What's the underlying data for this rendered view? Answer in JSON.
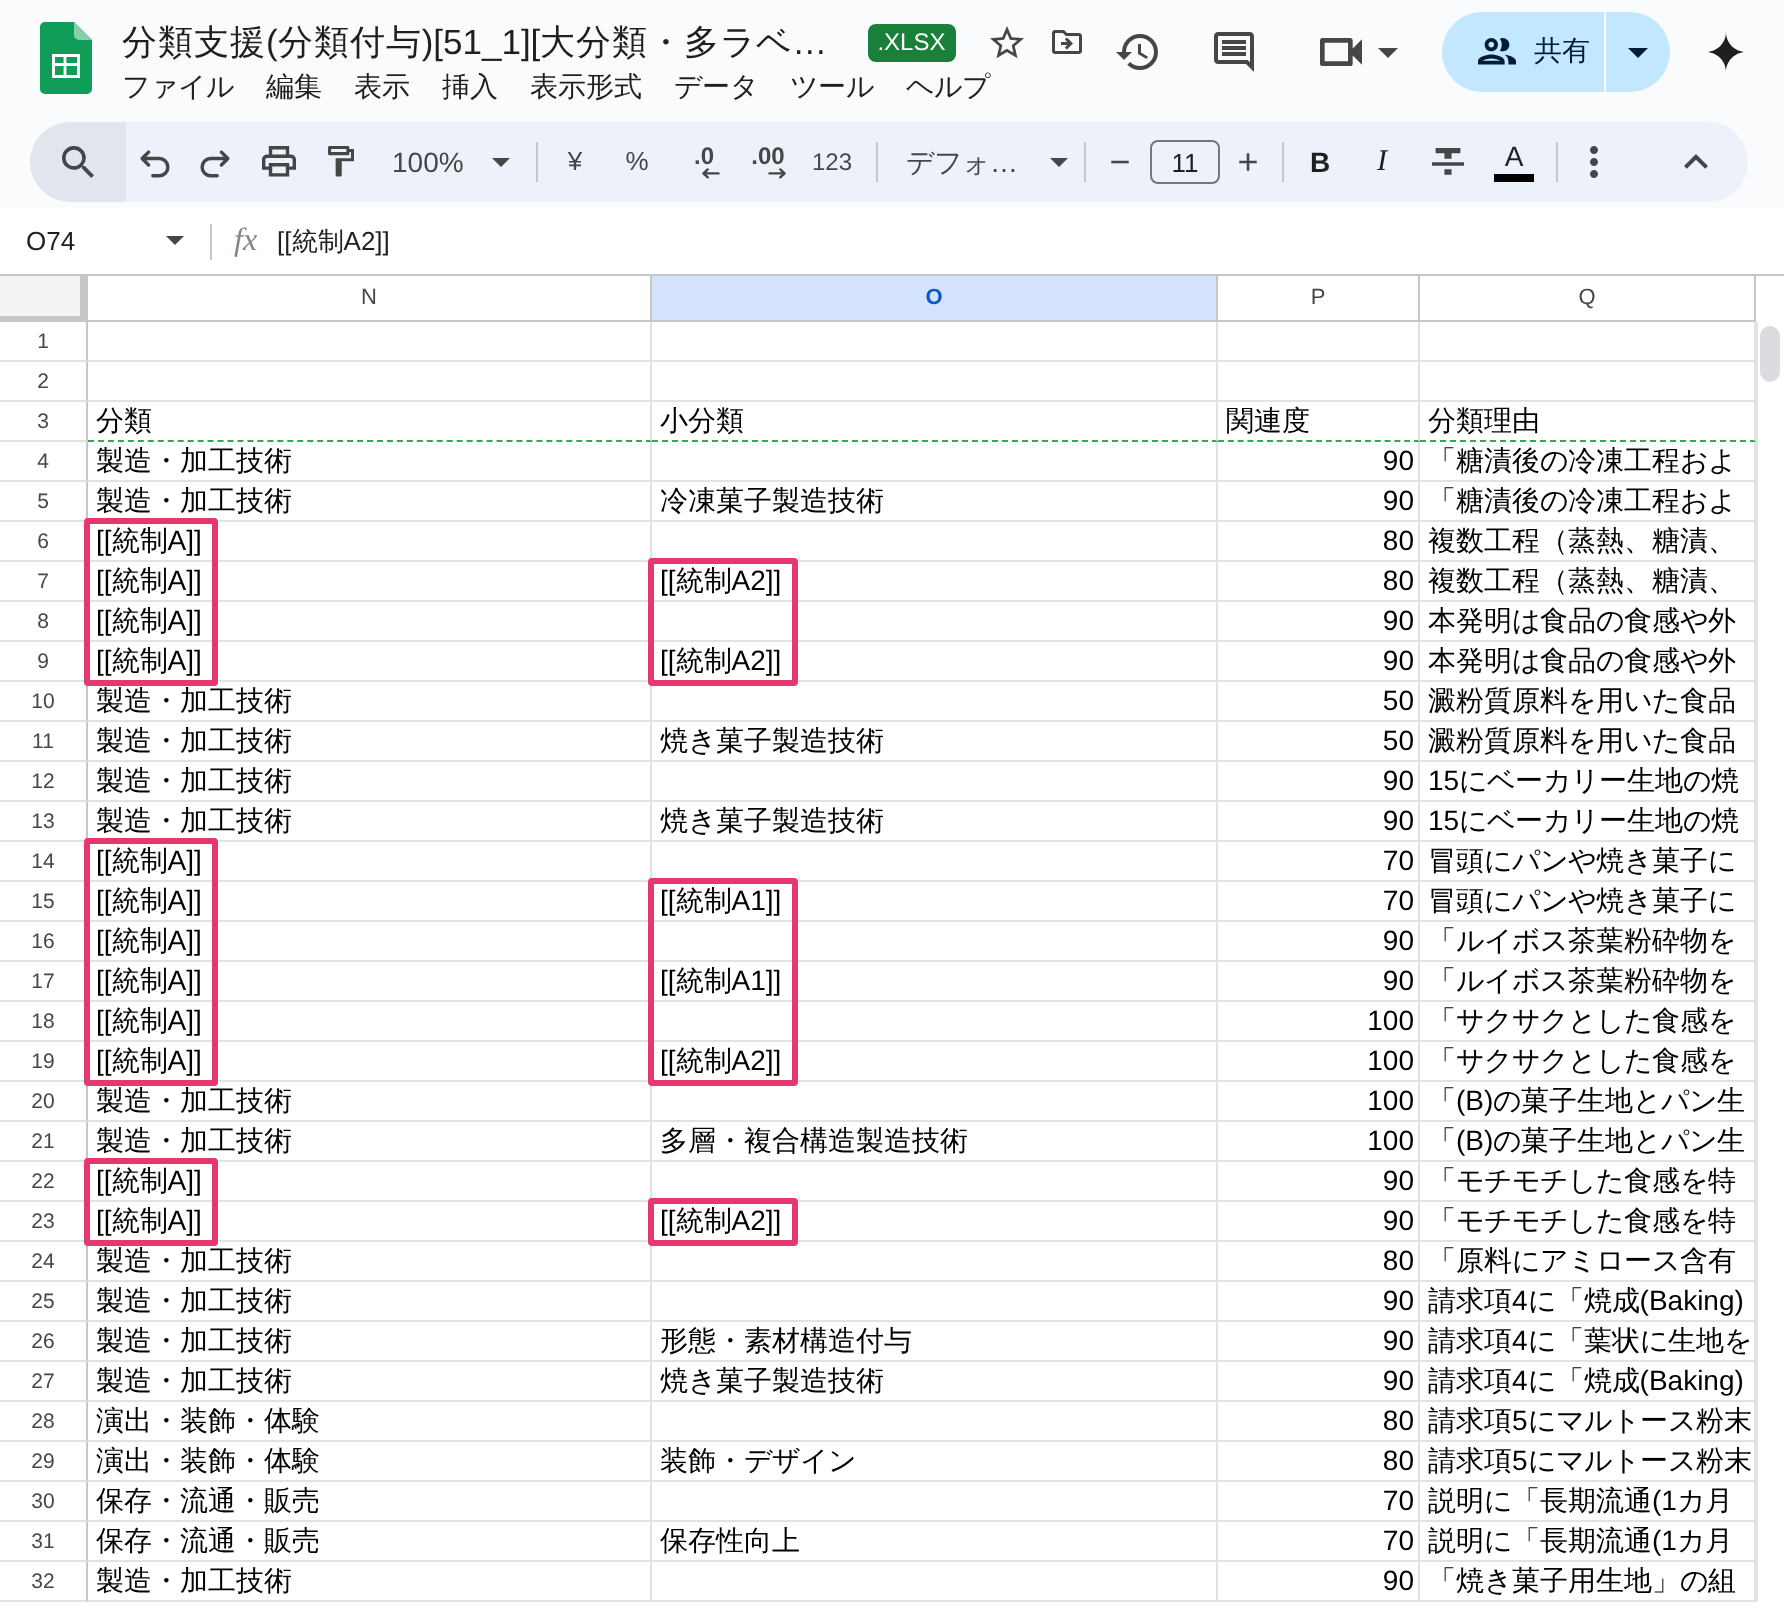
{
  "header": {
    "title": "分類支援(分類付与)[51_1][大分類・多ラベ…",
    "file_badge": ".XLSX",
    "menu": [
      "ファイル",
      "編集",
      "表示",
      "挿入",
      "表示形式",
      "データ",
      "ツール",
      "ヘルプ"
    ],
    "share_label": "共有"
  },
  "toolbar": {
    "zoom": "100%",
    "currency": "¥",
    "percent": "%",
    "decrease_decimal": ".0",
    "increase_decimal": ".00",
    "number_format": "123",
    "font": "デフォ…",
    "font_size_minus": "−",
    "font_size": "11",
    "font_size_plus": "+",
    "bold": "B",
    "italic": "I",
    "text_color": "A"
  },
  "formula_bar": {
    "cell_ref": "O74",
    "fx": "fx",
    "value": "[[統制A2]]"
  },
  "sheet": {
    "columns": [
      {
        "label": "N",
        "selected": false
      },
      {
        "label": "O",
        "selected": true
      },
      {
        "label": "P",
        "selected": false
      },
      {
        "label": "Q",
        "selected": false
      }
    ],
    "rows": [
      {
        "row": "1",
        "kind": "data",
        "boxed_n": false,
        "boxed_o": false
      },
      {
        "row": "2",
        "kind": "data",
        "boxed_n": false,
        "boxed_o": false
      },
      {
        "row": "3",
        "kind": "header",
        "n": "分類",
        "o": "小分類",
        "p": "関連度",
        "q": "分類理由",
        "boxed_n": false,
        "boxed_o": false
      },
      {
        "row": "4",
        "kind": "data",
        "n": "製造・加工技術",
        "p": "90",
        "q": "「糖漬後の冷凍工程およ",
        "boxed_n": false,
        "boxed_o": false
      },
      {
        "row": "5",
        "kind": "data",
        "n": "製造・加工技術",
        "o": "冷凍菓子製造技術",
        "p": "90",
        "q": "「糖漬後の冷凍工程およ",
        "boxed_n": false,
        "boxed_o": false
      },
      {
        "row": "6",
        "kind": "data",
        "n": "[[統制A]]",
        "p": "80",
        "q": "複数工程（蒸熱、糖漬、",
        "boxed_n": true,
        "boxed_o": false
      },
      {
        "row": "7",
        "kind": "data",
        "n": "[[統制A]]",
        "o": "[[統制A2]]",
        "p": "80",
        "q": "複数工程（蒸熱、糖漬、",
        "boxed_n": true,
        "boxed_o": true
      },
      {
        "row": "8",
        "kind": "data",
        "n": "[[統制A]]",
        "p": "90",
        "q": "本発明は食品の食感や外",
        "boxed_n": true,
        "boxed_o": true
      },
      {
        "row": "9",
        "kind": "data",
        "n": "[[統制A]]",
        "o": "[[統制A2]]",
        "p": "90",
        "q": "本発明は食品の食感や外",
        "boxed_n": true,
        "boxed_o": true
      },
      {
        "row": "10",
        "kind": "data",
        "n": "製造・加工技術",
        "p": "50",
        "q": "澱粉質原料を用いた食品",
        "boxed_n": false,
        "boxed_o": false
      },
      {
        "row": "11",
        "kind": "data",
        "n": "製造・加工技術",
        "o": "焼き菓子製造技術",
        "p": "50",
        "q": "澱粉質原料を用いた食品",
        "boxed_n": false,
        "boxed_o": false
      },
      {
        "row": "12",
        "kind": "data",
        "n": "製造・加工技術",
        "p": "90",
        "q": "15にベーカリー生地の焼",
        "boxed_n": false,
        "boxed_o": false
      },
      {
        "row": "13",
        "kind": "data",
        "n": "製造・加工技術",
        "o": "焼き菓子製造技術",
        "p": "90",
        "q": "15にベーカリー生地の焼",
        "boxed_n": false,
        "boxed_o": false
      },
      {
        "row": "14",
        "kind": "data",
        "n": "[[統制A]]",
        "p": "70",
        "q": "冒頭にパンや焼き菓子に",
        "boxed_n": true,
        "boxed_o": false
      },
      {
        "row": "15",
        "kind": "data",
        "n": "[[統制A]]",
        "o": "[[統制A1]]",
        "p": "70",
        "q": "冒頭にパンや焼き菓子に",
        "boxed_n": true,
        "boxed_o": true
      },
      {
        "row": "16",
        "kind": "data",
        "n": "[[統制A]]",
        "p": "90",
        "q": "「ルイボス茶葉粉砕物を",
        "boxed_n": true,
        "boxed_o": true
      },
      {
        "row": "17",
        "kind": "data",
        "n": "[[統制A]]",
        "o": "[[統制A1]]",
        "p": "90",
        "q": "「ルイボス茶葉粉砕物を",
        "boxed_n": true,
        "boxed_o": true
      },
      {
        "row": "18",
        "kind": "data",
        "n": "[[統制A]]",
        "p": "100",
        "q": "「サクサクとした食感を",
        "boxed_n": true,
        "boxed_o": true
      },
      {
        "row": "19",
        "kind": "data",
        "n": "[[統制A]]",
        "o": "[[統制A2]]",
        "p": "100",
        "q": "「サクサクとした食感を",
        "boxed_n": true,
        "boxed_o": true
      },
      {
        "row": "20",
        "kind": "data",
        "n": "製造・加工技術",
        "p": "100",
        "q": "「(B)の菓子生地とパン生",
        "boxed_n": false,
        "boxed_o": false
      },
      {
        "row": "21",
        "kind": "data",
        "n": "製造・加工技術",
        "o": "多層・複合構造製造技術",
        "p": "100",
        "q": "「(B)の菓子生地とパン生",
        "boxed_n": false,
        "boxed_o": false
      },
      {
        "row": "22",
        "kind": "data",
        "n": "[[統制A]]",
        "p": "90",
        "q": "「モチモチした食感を特",
        "boxed_n": true,
        "boxed_o": false
      },
      {
        "row": "23",
        "kind": "data",
        "n": "[[統制A]]",
        "o": "[[統制A2]]",
        "p": "90",
        "q": "「モチモチした食感を特",
        "boxed_n": true,
        "boxed_o": true
      },
      {
        "row": "24",
        "kind": "data",
        "n": "製造・加工技術",
        "p": "80",
        "q": "「原料にアミロース含有",
        "boxed_n": false,
        "boxed_o": false
      },
      {
        "row": "25",
        "kind": "data",
        "n": "製造・加工技術",
        "p": "90",
        "q": "請求項4に「焼成(Baking)",
        "boxed_n": false,
        "boxed_o": false
      },
      {
        "row": "26",
        "kind": "data",
        "n": "製造・加工技術",
        "o": "形態・素材構造付与",
        "p": "90",
        "q": "請求項4に「葉状に生地を",
        "boxed_n": false,
        "boxed_o": false
      },
      {
        "row": "27",
        "kind": "data",
        "n": "製造・加工技術",
        "o": "焼き菓子製造技術",
        "p": "90",
        "q": "請求項4に「焼成(Baking)",
        "boxed_n": false,
        "boxed_o": false
      },
      {
        "row": "28",
        "kind": "data",
        "n": "演出・装飾・体験",
        "p": "80",
        "q": "請求項5にマルトース粉末",
        "boxed_n": false,
        "boxed_o": false
      },
      {
        "row": "29",
        "kind": "data",
        "n": "演出・装飾・体験",
        "o": "装飾・デザイン",
        "p": "80",
        "q": "請求項5にマルトース粉末",
        "boxed_n": false,
        "boxed_o": false
      },
      {
        "row": "30",
        "kind": "data",
        "n": "保存・流通・販売",
        "p": "70",
        "q": "説明に「長期流通(1カ月",
        "boxed_n": false,
        "boxed_o": false
      },
      {
        "row": "31",
        "kind": "data",
        "n": "保存・流通・販売",
        "o": "保存性向上",
        "p": "70",
        "q": "説明に「長期流通(1カ月",
        "boxed_n": false,
        "boxed_o": false
      },
      {
        "row": "32",
        "kind": "data",
        "n": "製造・加工技術",
        "p": "90",
        "q": "「焼き菓子用生地」の組",
        "boxed_n": false,
        "boxed_o": false
      }
    ]
  }
}
